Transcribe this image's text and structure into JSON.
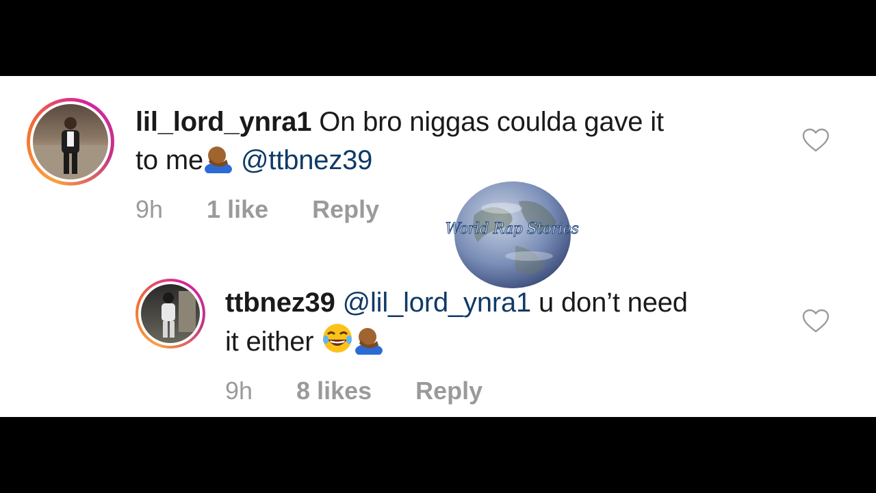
{
  "comments": [
    {
      "username": "lil_lord_ynra1",
      "text_line1": "On bro niggas coulda gave it",
      "text_line2": "to me",
      "mention": "@ttbnez39",
      "time": "9h",
      "likes": "1 like",
      "reply": "Reply"
    },
    {
      "username": "ttbnez39",
      "mention": "@lil_lord_ynra1",
      "text_line1": "u don’t need",
      "text_line2": "it either",
      "time": "9h",
      "likes": "8 likes",
      "reply": "Reply"
    }
  ],
  "watermark": {
    "text": "World Rap Stories"
  },
  "icons": [
    "heart-icon",
    "facepalm-emoji",
    "laughing-emoji"
  ]
}
